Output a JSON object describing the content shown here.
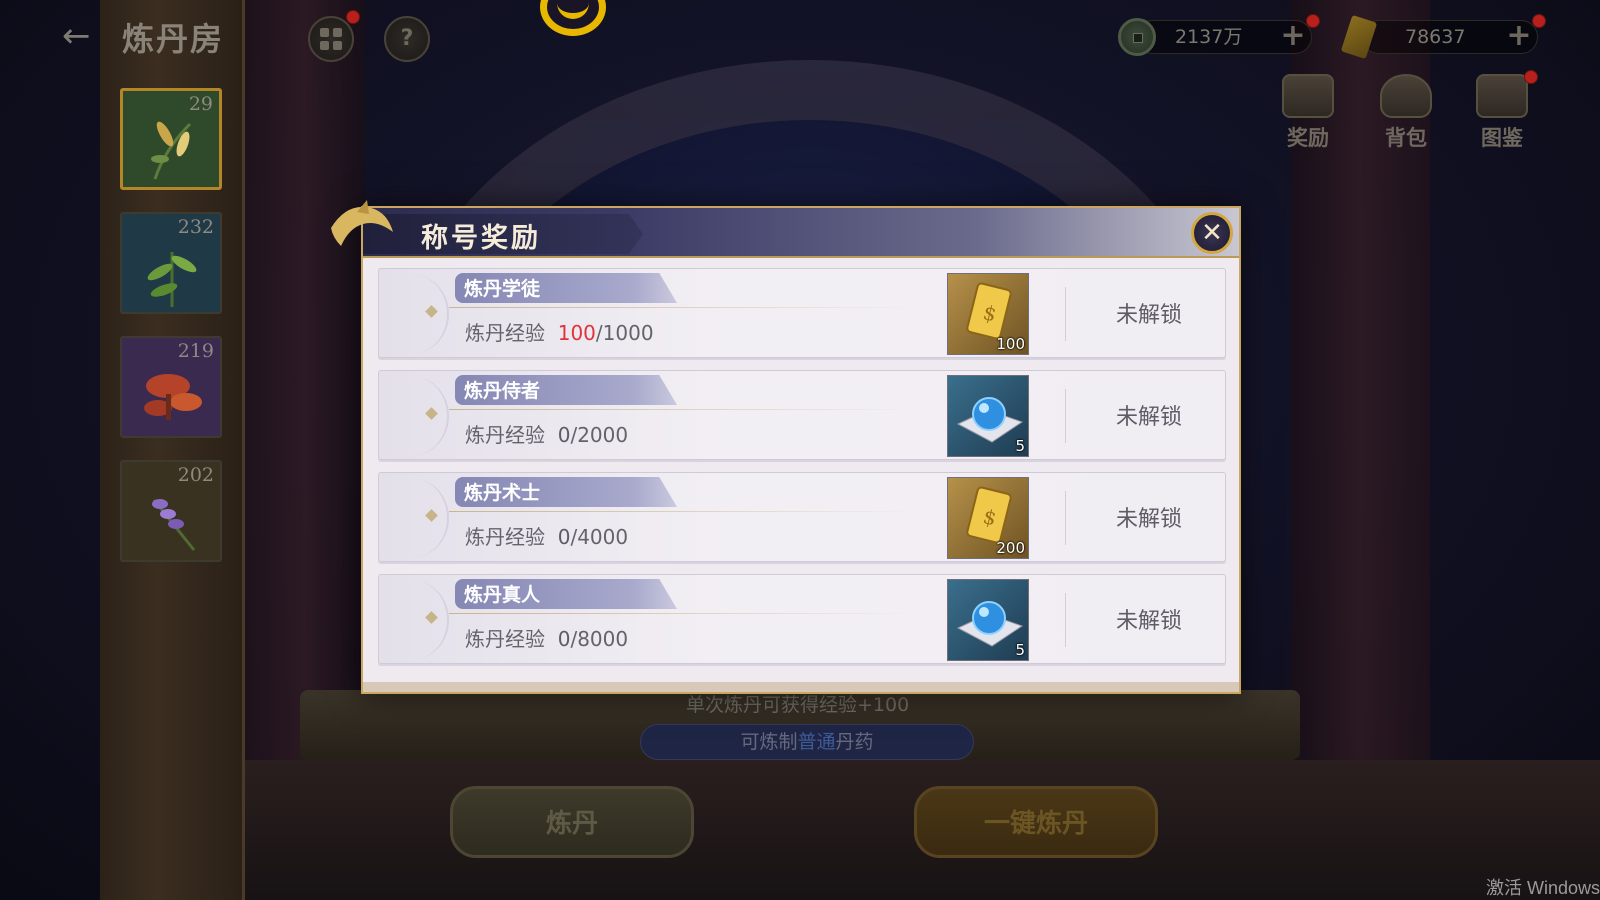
{
  "header": {
    "back_glyph": "←",
    "title": "炼丹房",
    "help_glyph": "?"
  },
  "herbs": [
    {
      "count": "29",
      "color": "#2f4a2a",
      "selected": true
    },
    {
      "count": "232",
      "color": "#1f3a46",
      "selected": false
    },
    {
      "count": "219",
      "color": "#3a2a50",
      "selected": false
    },
    {
      "count": "202",
      "color": "#3a3220",
      "selected": false
    }
  ],
  "currency": {
    "coins": "2137万",
    "tickets": "78637"
  },
  "menu": {
    "reward": "奖励",
    "bag": "背包",
    "codex": "图鉴"
  },
  "background": {
    "hint": "单次炼丹可获得经验+100",
    "recipe_prefix": "可炼制",
    "recipe_type": "普通",
    "recipe_suffix": "丹药",
    "refine_button": "炼丹",
    "one_click_button": "一键炼丹"
  },
  "modal": {
    "title": "称号奖励",
    "close_glyph": "✕",
    "rows": [
      {
        "rank": "炼丹学徒",
        "exp_label": "炼丹经验",
        "exp_current": "100",
        "exp_target": "/1000",
        "reward_type": "gold-ticket-icon",
        "reward_qty": "100",
        "status": "未解锁"
      },
      {
        "rank": "炼丹侍者",
        "exp_label": "炼丹经验",
        "exp_current": "0",
        "exp_target": "/2000",
        "reward_type": "blue-orb-icon",
        "reward_qty": "5",
        "status": "未解锁"
      },
      {
        "rank": "炼丹术士",
        "exp_label": "炼丹经验",
        "exp_current": "0",
        "exp_target": "/4000",
        "reward_type": "gold-ticket-icon",
        "reward_qty": "200",
        "status": "未解锁"
      },
      {
        "rank": "炼丹真人",
        "exp_label": "炼丹经验",
        "exp_current": "0",
        "exp_target": "/8000",
        "reward_type": "blue-orb-icon",
        "reward_qty": "5",
        "status": "未解锁"
      }
    ]
  },
  "watermark": "激活 Windows",
  "colors": {
    "accent_gold": "#caa661",
    "progress_red": "#e0333a",
    "modal_bg": "#eeeaf0"
  }
}
